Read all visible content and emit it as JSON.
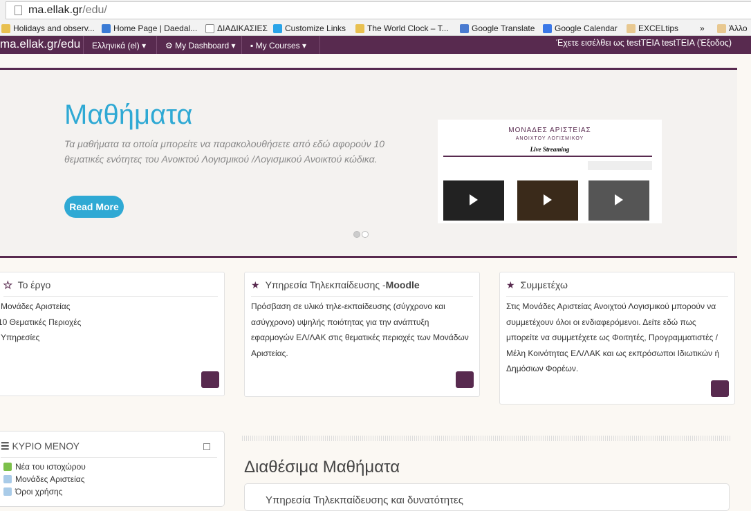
{
  "browser": {
    "url_host": "ma.ellak.gr",
    "url_path": "/edu/",
    "bookmarks": [
      {
        "label": "Holidays and observ...",
        "icon": "clock-icon"
      },
      {
        "label": "Home Page | Daedal...",
        "icon": "bird-icon"
      },
      {
        "label": "ΔΙΑΔΙΚΑΣΙΕΣ",
        "icon": "page-icon"
      },
      {
        "label": "Customize Links",
        "icon": "windows-icon"
      },
      {
        "label": "The World Clock – T...",
        "icon": "clock-icon"
      },
      {
        "label": "Google Translate",
        "icon": "translate-icon"
      },
      {
        "label": "Google Calendar",
        "icon": "calendar-icon"
      },
      {
        "label": "EXCELtips",
        "icon": "folder-icon"
      }
    ],
    "overflow": "»",
    "other": "Άλλο"
  },
  "nav": {
    "brand": "ma.ellak.gr/edu",
    "language": "Ελληνικά (el)",
    "dashboard": "My Dashboard",
    "courses": "My Courses",
    "login": "Έχετε εισέλθει ως testTEIA testTEIA (Έξοδος)"
  },
  "hero": {
    "title": "Μαθήματα",
    "text": "Τα μαθήματα τα οποία μπορείτε να παρακολουθήσετε από εδώ αφορούν 10 θεματικές ενότητες του Ανοικτού Λογισμικού /Λογισμικού Ανοικτού κώδικα.",
    "button": "Read More",
    "image": {
      "title": "ΜΟΝΑΔΕΣ ΑΡΙΣΤΕΙΑΣ",
      "subtitle": "ΑΝΟΙΧΤΟΥ ΛΟΓΙΣΜΙΚΟΥ",
      "heading": "Live Streaming"
    },
    "slide_active": 1,
    "slides": 2
  },
  "cards": [
    {
      "title": "Το έργο",
      "items": [
        "Μονάδες Αριστείας",
        "10 Θεματικές Περιοχές",
        "Υπηρεσίες"
      ]
    },
    {
      "title": "Υπηρεσία Τηλεκπαίδευσης -",
      "title_bold": "Moodle",
      "text": "Πρόσβαση σε υλικό τηλε-εκπαίδευσης (σύγχρονο και ασύγχρονο) υψηλής ποιότητας για την ανάπτυξη εφαρμογών ΕΛ/ΛΑΚ στις θεματικές περιοχές των Μονάδων Αριστείας."
    },
    {
      "title": "Συμμετέχω",
      "text": "Στις Μονάδες Αριστείας Ανοιχτού Λογισμικού μπορούν να συμμετέχουν όλοι οι ενδιαφερόμενοι. Δείτε εδώ πως μπορείτε να συμμετέχετε ως Φοιτητές, Προγραμματιστές / Μέλη Κοινότητας ΕΛ/ΛΑΚ και ως εκπρόσωποι Ιδιωτικών ή Δημόσιων Φορέων."
    }
  ],
  "menu": {
    "title": "ΚΥΡΙΟ ΜΕΝΟΥ",
    "items": [
      "Νέα του ιστοχώρου",
      "Μονάδες Αριστείας",
      "Όροι χρήσης"
    ]
  },
  "available": {
    "title": "Διαθέσιμα Μαθήματα",
    "first": "Υπηρεσία Τηλεκπαίδευσης και δυνατότητες"
  },
  "colors": {
    "brand": "#582a4f",
    "accent": "#2fa9d4"
  }
}
